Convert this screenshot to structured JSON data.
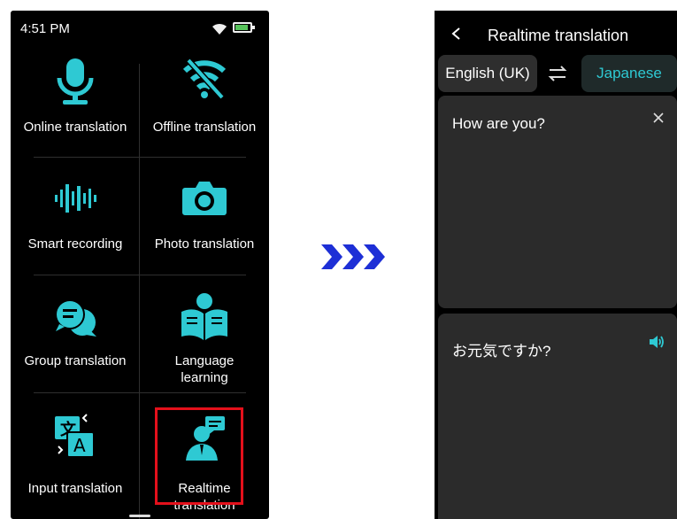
{
  "left_screen": {
    "status_time": "4:51 PM",
    "tiles": [
      {
        "label": "Online translation",
        "icon": "microphone-icon"
      },
      {
        "label": "Offline translation",
        "icon": "wifi-off-icon"
      },
      {
        "label": "Smart recording",
        "icon": "audio-wave-icon"
      },
      {
        "label": "Photo translation",
        "icon": "camera-icon"
      },
      {
        "label": "Group translation",
        "icon": "chat-bubbles-icon"
      },
      {
        "label_line1": "Language",
        "label_line2": "learning",
        "icon": "reading-person-icon"
      },
      {
        "label": "Input translation",
        "icon": "text-translate-icon"
      },
      {
        "label_line1": "Realtime",
        "label_line2": "translation",
        "icon": "speaker-person-icon"
      }
    ]
  },
  "right_screen": {
    "title": "Realtime translation",
    "source_language": "English (UK)",
    "target_language": "Japanese",
    "source_text": "How are you?",
    "translated_text": "お元気ですか?"
  },
  "colors": {
    "accent": "#2ec9d3",
    "highlight": "#e4101b",
    "arrow": "#1d2fd6",
    "panel": "#2b2b2b"
  }
}
